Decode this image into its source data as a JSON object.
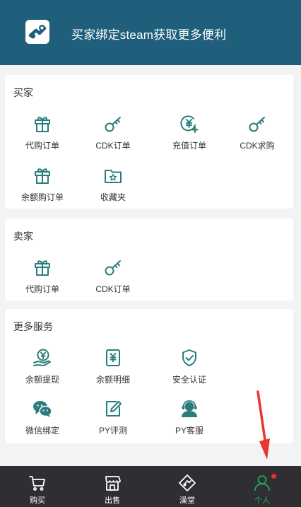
{
  "header": {
    "title": "买家绑定steam获取更多便利",
    "logo_icon": "steam-logo-icon"
  },
  "colors": {
    "header_bg": "#1f5f7c",
    "icon_teal": "#2a7d7d",
    "tabbar_bg": "#2f2f33",
    "active_tab": "#26a65b",
    "badge": "#e5322d",
    "arrow": "#e8352e"
  },
  "buyer": {
    "title": "买家",
    "items": [
      {
        "label": "代购订单",
        "icon": "gift-icon"
      },
      {
        "label": "CDK订单",
        "icon": "key-icon"
      },
      {
        "label": "充值订单",
        "icon": "yuan-recharge-icon"
      },
      {
        "label": "CDK求购",
        "icon": "key-icon"
      },
      {
        "label": "余额购订单",
        "icon": "gift-icon"
      },
      {
        "label": "收藏夹",
        "icon": "star-folder-icon"
      }
    ]
  },
  "seller": {
    "title": "卖家",
    "items": [
      {
        "label": "代购订单",
        "icon": "gift-icon"
      },
      {
        "label": "CDK订单",
        "icon": "key-icon"
      }
    ]
  },
  "services": {
    "title": "更多服务",
    "items": [
      {
        "label": "余额提现",
        "icon": "coin-hand-icon"
      },
      {
        "label": "余额明细",
        "icon": "yuan-document-icon"
      },
      {
        "label": "安全认证",
        "icon": "shield-check-icon"
      },
      {
        "label": "微信绑定",
        "icon": "wechat-icon"
      },
      {
        "label": "PY评测",
        "icon": "edit-icon"
      },
      {
        "label": "PY客服",
        "icon": "headset-icon"
      }
    ]
  },
  "tabbar": {
    "tabs": [
      {
        "label": "购买",
        "icon": "cart-icon"
      },
      {
        "label": "出售",
        "icon": "store-icon"
      },
      {
        "label": "澡堂",
        "icon": "bath-icon"
      },
      {
        "label": "个人",
        "icon": "person-icon",
        "active": true,
        "badge": true
      }
    ]
  }
}
